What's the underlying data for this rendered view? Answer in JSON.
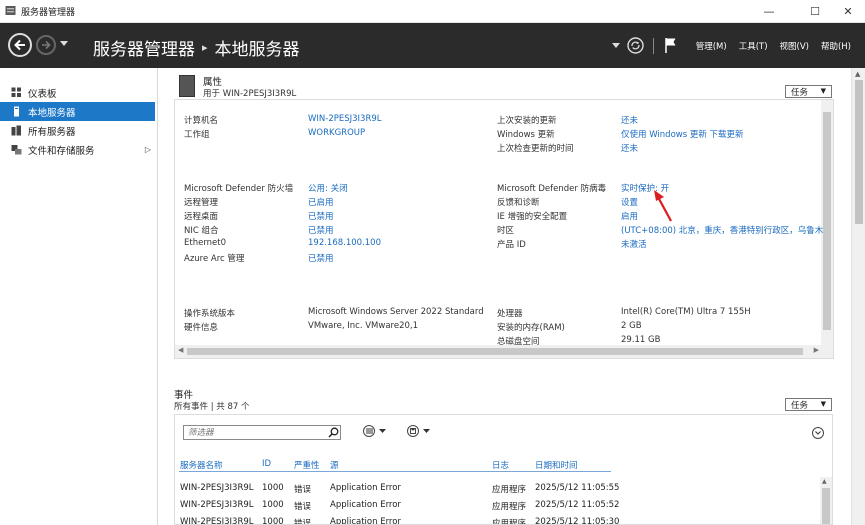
{
  "window": {
    "title": "服务器管理器",
    "min": "—",
    "max": "☐",
    "close": "✕"
  },
  "header": {
    "breadcrumb_root": "服务器管理器",
    "breadcrumb_sep": "▸",
    "breadcrumb_current": "本地服务器",
    "menus": [
      "管理(M)",
      "工具(T)",
      "视图(V)",
      "帮助(H)"
    ]
  },
  "sidebar": {
    "items": [
      {
        "label": "仪表板",
        "icon": "dashboard-icon"
      },
      {
        "label": "本地服务器",
        "icon": "server-icon",
        "active": true
      },
      {
        "label": "所有服务器",
        "icon": "servers-icon"
      },
      {
        "label": "文件和存储服务",
        "icon": "storage-icon",
        "arrow": "▷"
      }
    ]
  },
  "properties": {
    "heading": "属性",
    "subheading": "用于 WIN-2PESJ3I3R9L",
    "tasks_label": "任务",
    "left_col": [
      {
        "label": "计算机名",
        "value": "WIN-2PESJ3I3R9L",
        "link": true
      },
      {
        "label": "工作组",
        "value": "WORKGROUP",
        "link": true
      },
      {
        "label": "Microsoft Defender 防火墙",
        "value": "公用: 关闭",
        "link": true
      },
      {
        "label": "远程管理",
        "value": "已启用",
        "link": true
      },
      {
        "label": "远程桌面",
        "value": "已禁用",
        "link": true
      },
      {
        "label": "NIC 组合",
        "value": "已禁用",
        "link": true
      },
      {
        "label": "Ethernet0",
        "value": "192.168.100.100",
        "link": true
      },
      {
        "label": "Azure Arc 管理",
        "value": "已禁用",
        "link": true
      },
      {
        "label": "操作系统版本",
        "value": "Microsoft Windows Server 2022 Standard",
        "link": false
      },
      {
        "label": "硬件信息",
        "value": "VMware, Inc. VMware20,1",
        "link": false
      }
    ],
    "right_col": [
      {
        "label": "上次安装的更新",
        "value": "还未",
        "link": true
      },
      {
        "label": "Windows 更新",
        "value": "仅使用 Windows 更新 下载更新",
        "link": true
      },
      {
        "label": "上次检查更新的时间",
        "value": "还未",
        "link": true
      },
      {
        "label": "Microsoft Defender 防病毒",
        "value": "实时保护: 开",
        "link": true
      },
      {
        "label": "反馈和诊断",
        "value": "设置",
        "link": true
      },
      {
        "label": "IE 增强的安全配置",
        "value": "启用",
        "link": true
      },
      {
        "label": "时区",
        "value": "(UTC+08:00) 北京，重庆，香港特别行政区，乌鲁木",
        "link": true
      },
      {
        "label": "产品 ID",
        "value": "未激活",
        "link": true
      },
      {
        "label": "处理器",
        "value": "Intel(R) Core(TM) Ultra 7 155H",
        "link": false
      },
      {
        "label": "安装的内存(RAM)",
        "value": "2 GB",
        "link": false
      },
      {
        "label": "总磁盘空间",
        "value": "29.11 GB",
        "link": false
      }
    ]
  },
  "events": {
    "heading": "事件",
    "subheading": "所有事件 | 共 87 个",
    "tasks_label": "任务",
    "filter_placeholder": "筛选器",
    "columns": [
      "服务器名称",
      "ID",
      "严重性",
      "源",
      "日志",
      "日期和时间"
    ],
    "rows": [
      [
        "WIN-2PESJ3I3R9L",
        "1000",
        "错误",
        "Application Error",
        "应用程序",
        "2025/5/12 11:05:55"
      ],
      [
        "WIN-2PESJ3I3R9L",
        "1000",
        "错误",
        "Application Error",
        "应用程序",
        "2025/5/12 11:05:52"
      ],
      [
        "WIN-2PESJ3I3R9L",
        "1000",
        "错误",
        "Application Error",
        "应用程序",
        "2025/5/12 11:05:30"
      ]
    ]
  },
  "colors": {
    "accent": "#1e78c8",
    "header_bg": "#2b2b2b",
    "link": "#1a6bc0",
    "annotation_arrow": "#d81e1e"
  }
}
